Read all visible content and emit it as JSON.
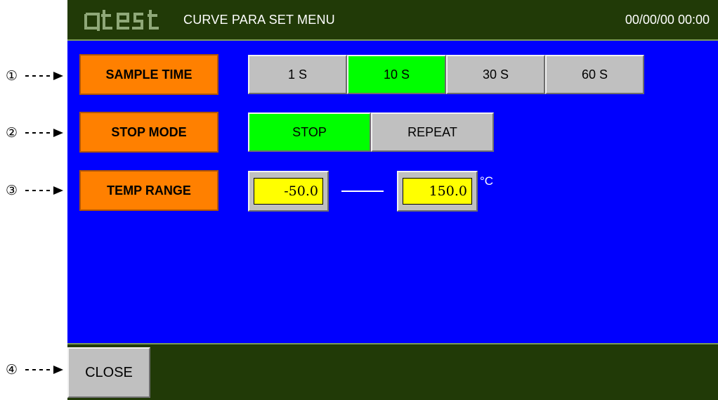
{
  "callouts": [
    "①",
    "②",
    "③",
    "④"
  ],
  "header": {
    "logo_text": "qtest",
    "title": "CURVE PARA SET MENU",
    "datetime": "00/00/00 00:00"
  },
  "sample_time": {
    "label": "SAMPLE TIME",
    "options": [
      "1 S",
      "10 S",
      "30 S",
      "60 S"
    ],
    "selected": "10 S"
  },
  "stop_mode": {
    "label": "STOP MODE",
    "options": [
      "STOP",
      "REPEAT"
    ],
    "selected": "STOP"
  },
  "temp_range": {
    "label": "TEMP RANGE",
    "min": "-50.0",
    "max": "150.0",
    "unit": "°C"
  },
  "footer": {
    "close_label": "CLOSE"
  },
  "colors": {
    "screen_bg": "#0000fe",
    "bar_bg": "#213a07",
    "label_orange": "#ff8000",
    "selected_green": "#00ff00",
    "unselected_gray": "#c0c0c0",
    "value_yellow": "#ffff00"
  }
}
